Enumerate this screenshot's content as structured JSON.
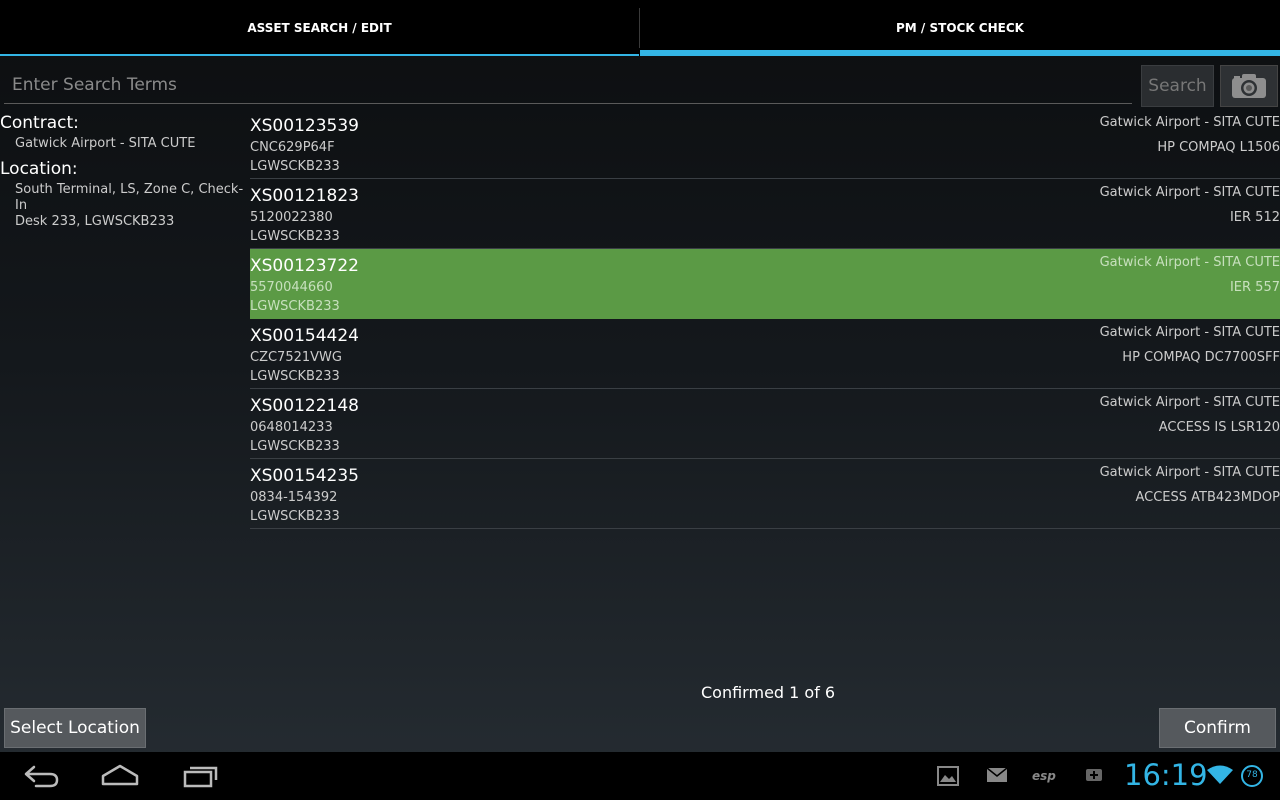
{
  "tabs": [
    {
      "label": "ASSET SEARCH / EDIT"
    },
    {
      "label": "PM / STOCK CHECK"
    }
  ],
  "search": {
    "placeholder": "Enter Search Terms",
    "button_label": "Search"
  },
  "left_panel": {
    "contract_label": "Contract:",
    "contract_value": "Gatwick Airport - SITA CUTE",
    "location_label": "Location:",
    "location_value_line1": "South Terminal, LS, Zone C, Check-In",
    "location_value_line2": "Desk 233, LGWSCKB233"
  },
  "assets": [
    {
      "id": "XS00123539",
      "serial": "CNC629P64F",
      "location": "LGWSCKB233",
      "contract": "Gatwick Airport - SITA CUTE",
      "model": "HP COMPAQ L1506"
    },
    {
      "id": "XS00121823",
      "serial": "5120022380",
      "location": "LGWSCKB233",
      "contract": "Gatwick Airport - SITA CUTE",
      "model": "IER 512"
    },
    {
      "id": "XS00123722",
      "serial": "5570044660",
      "location": "LGWSCKB233",
      "contract": "Gatwick Airport - SITA CUTE",
      "model": "IER 557"
    },
    {
      "id": "XS00154424",
      "serial": "CZC7521VWG",
      "location": "LGWSCKB233",
      "contract": "Gatwick Airport - SITA CUTE",
      "model": "HP COMPAQ DC7700SFF"
    },
    {
      "id": "XS00122148",
      "serial": "0648014233",
      "location": "LGWSCKB233",
      "contract": "Gatwick Airport - SITA CUTE",
      "model": "ACCESS IS LSR120"
    },
    {
      "id": "XS00154235",
      "serial": "0834-154392",
      "location": "LGWSCKB233",
      "contract": "Gatwick Airport - SITA CUTE",
      "model": "ACCESS ATB423MDOP"
    }
  ],
  "status": {
    "confirmed_text": "Confirmed 1 of 6"
  },
  "buttons": {
    "select_location": "Select Location",
    "confirm": "Confirm"
  },
  "system_bar": {
    "time": "16:19",
    "battery": "78"
  },
  "colors": {
    "accent": "#33b5e5",
    "selected_row": "#5b9a45"
  }
}
